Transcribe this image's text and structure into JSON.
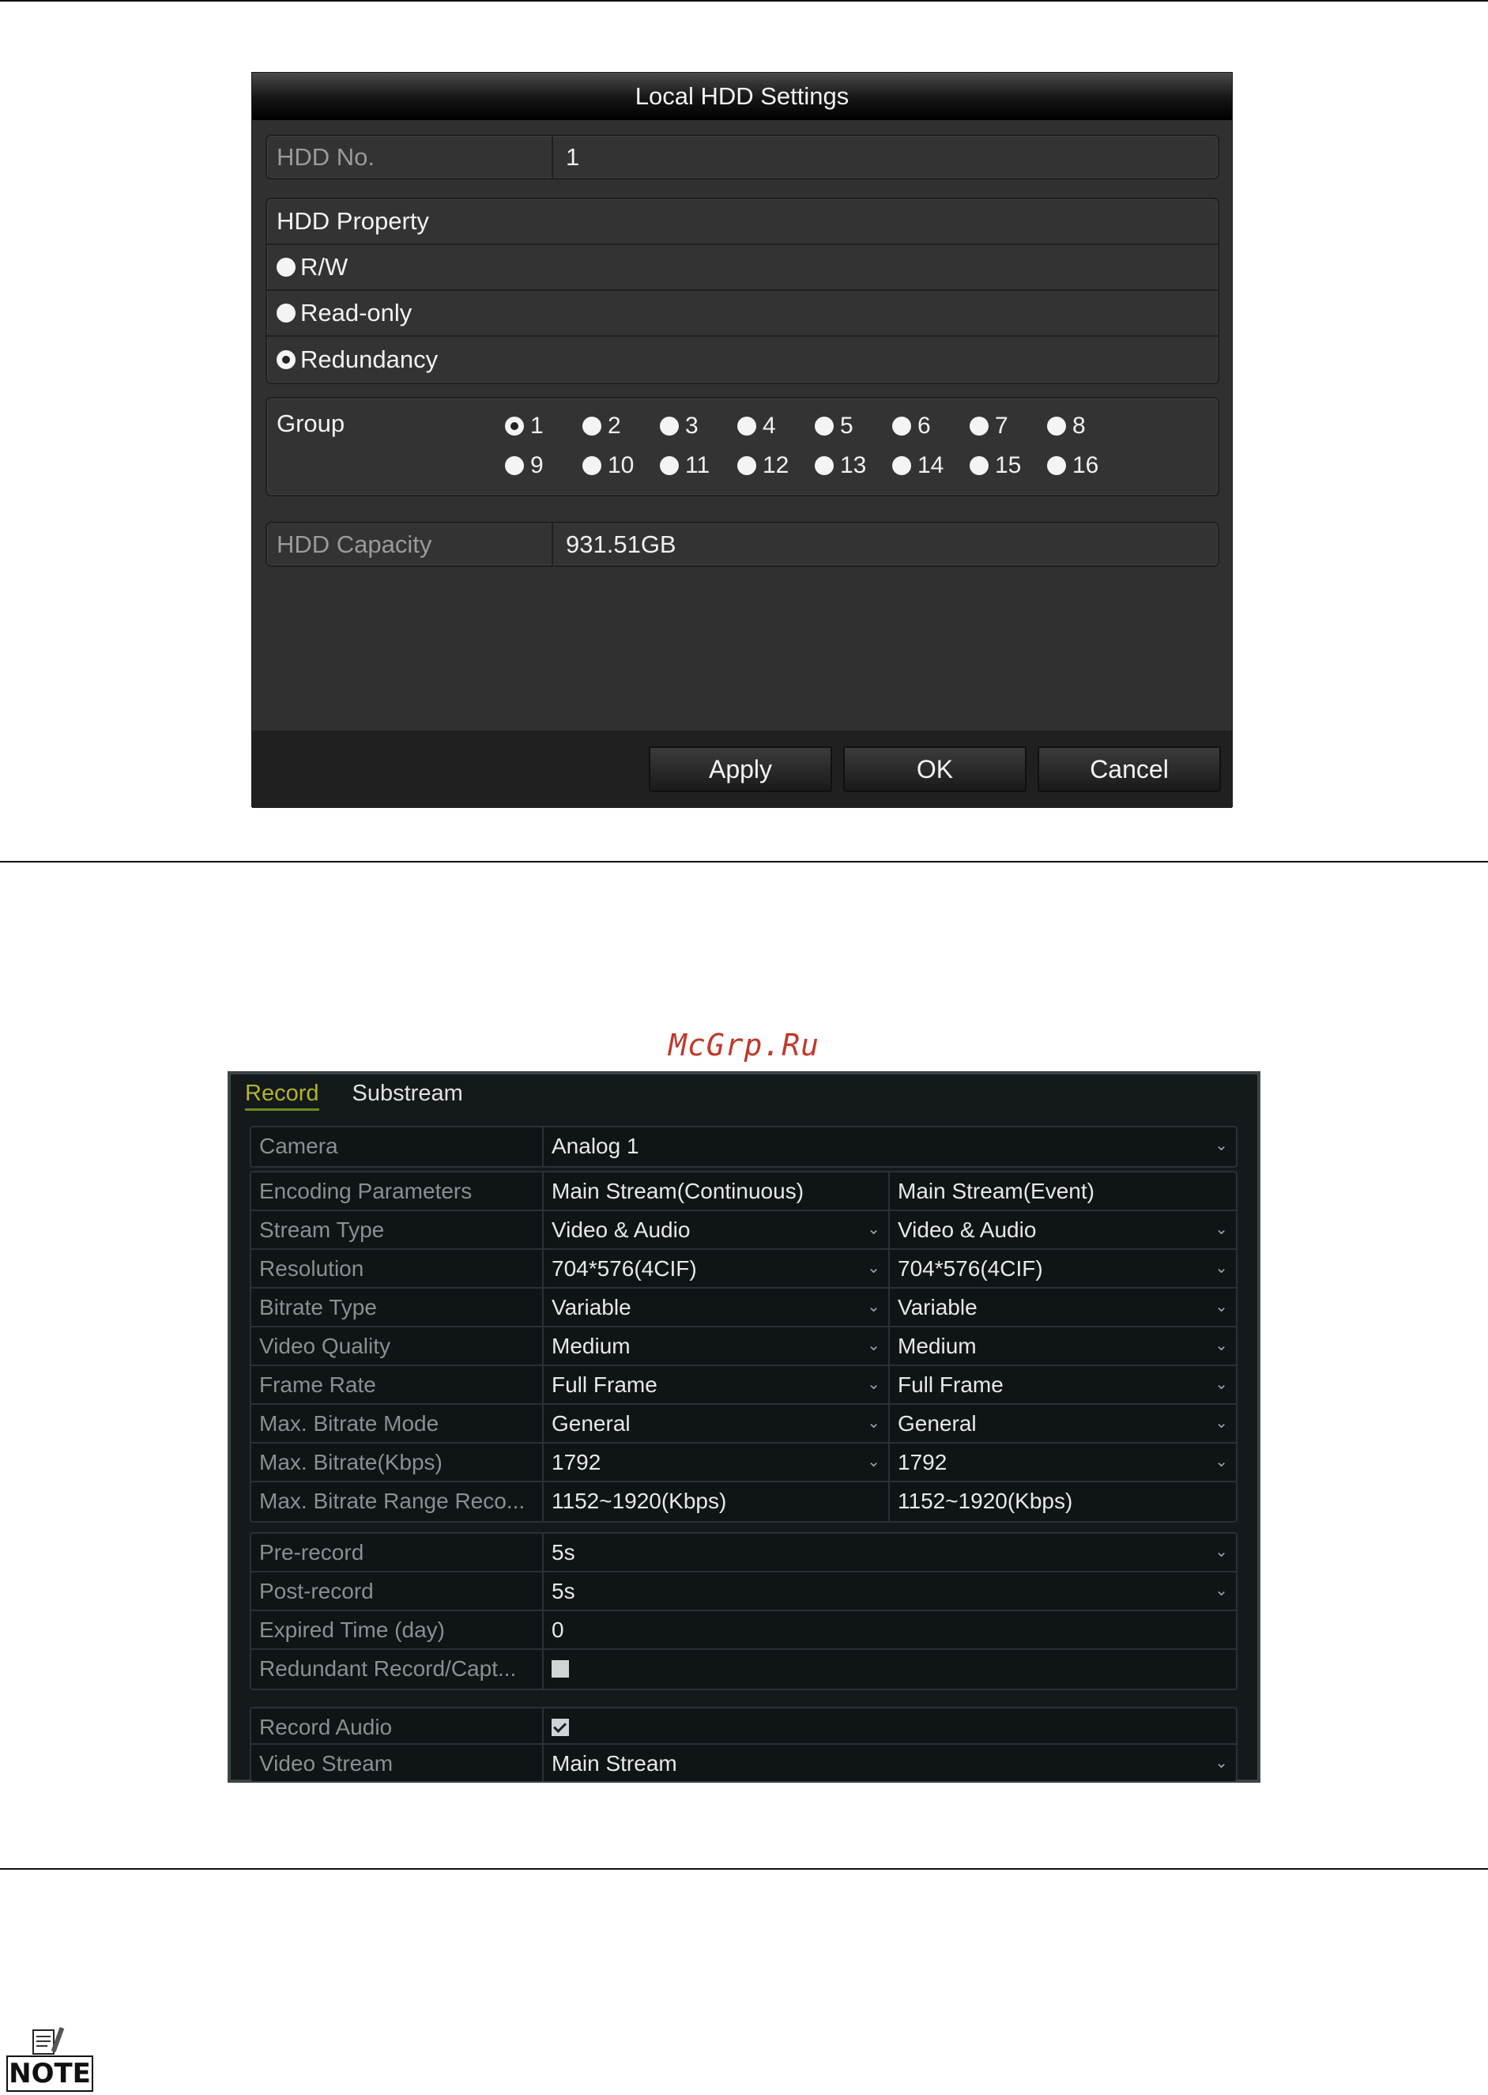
{
  "hdd_dialog": {
    "title": "Local HDD Settings",
    "hdd_no_label": "HDD No.",
    "hdd_no_value": "1",
    "property_label": "HDD Property",
    "properties": [
      {
        "label": "R/W",
        "selected": false
      },
      {
        "label": "Read-only",
        "selected": false
      },
      {
        "label": "Redundancy",
        "selected": true
      }
    ],
    "group_label": "Group",
    "groups": [
      "1",
      "2",
      "3",
      "4",
      "5",
      "6",
      "7",
      "8",
      "9",
      "10",
      "11",
      "12",
      "13",
      "14",
      "15",
      "16"
    ],
    "group_selected": "1",
    "capacity_label": "HDD Capacity",
    "capacity_value": "931.51GB",
    "buttons": {
      "apply": "Apply",
      "ok": "OK",
      "cancel": "Cancel"
    }
  },
  "watermark": "McGrp.Ru",
  "record_panel": {
    "tabs": [
      {
        "label": "Record",
        "active": true
      },
      {
        "label": "Substream",
        "active": false
      }
    ],
    "camera": {
      "label": "Camera",
      "value": "Analog 1"
    },
    "encoding_rows": [
      {
        "label": "Encoding Parameters",
        "main": "Main Stream(Continuous)",
        "event": "Main Stream(Event)",
        "dropdown": false
      },
      {
        "label": "Stream Type",
        "main": "Video & Audio",
        "event": "Video & Audio",
        "dropdown": true
      },
      {
        "label": "Resolution",
        "main": "704*576(4CIF)",
        "event": "704*576(4CIF)",
        "dropdown": true
      },
      {
        "label": "Bitrate Type",
        "main": "Variable",
        "event": "Variable",
        "dropdown": true
      },
      {
        "label": "Video Quality",
        "main": "Medium",
        "event": "Medium",
        "dropdown": true
      },
      {
        "label": "Frame Rate",
        "main": "Full Frame",
        "event": "Full Frame",
        "dropdown": true
      },
      {
        "label": "Max. Bitrate Mode",
        "main": "General",
        "event": "General",
        "dropdown": true
      },
      {
        "label": "Max. Bitrate(Kbps)",
        "main": "1792",
        "event": "1792",
        "dropdown": true
      },
      {
        "label": "Max. Bitrate Range Reco...",
        "main": "1152~1920(Kbps)",
        "event": "1152~1920(Kbps)",
        "dropdown": false
      }
    ],
    "pre_record": {
      "label": "Pre-record",
      "value": "5s"
    },
    "post_record": {
      "label": "Post-record",
      "value": "5s"
    },
    "expired_time": {
      "label": "Expired Time (day)",
      "value": "0"
    },
    "redundant": {
      "label": "Redundant Record/Capt...",
      "checked": false
    },
    "record_audio": {
      "label": "Record Audio",
      "checked": true
    },
    "video_stream": {
      "label": "Video Stream",
      "value": "Main Stream"
    }
  },
  "note": {
    "label": "NOTE"
  }
}
